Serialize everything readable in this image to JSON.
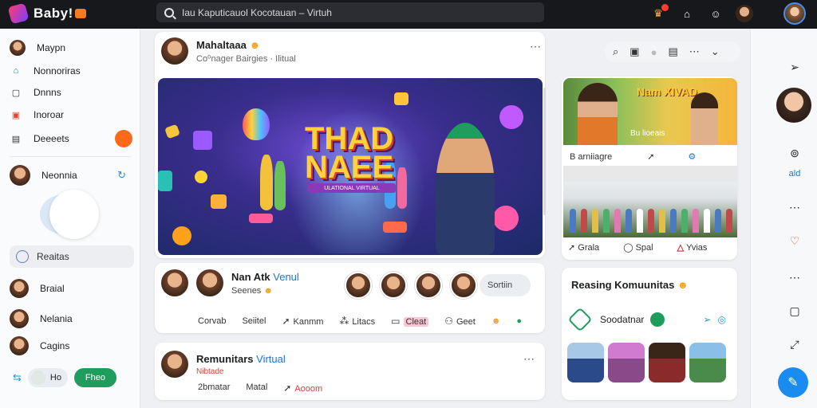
{
  "app": {
    "logo_text": "Baby!"
  },
  "search": {
    "value": "Iau Kaputicauol Kocotauan – Virtuh"
  },
  "sidebar": {
    "items": [
      {
        "label": "Maypn",
        "icon": "profile-icon"
      },
      {
        "label": "Nonnoriras",
        "icon": "notifications-icon"
      },
      {
        "label": "Dnnns",
        "icon": "messages-icon"
      },
      {
        "label": "Inoroar",
        "icon": "events-icon"
      },
      {
        "label": "Deeeets",
        "icon": "saved-icon"
      }
    ],
    "community": {
      "label": "Neonnia"
    },
    "search_pill": "Reaitas",
    "people": [
      {
        "label": "Braial"
      },
      {
        "label": "Nelania"
      },
      {
        "label": "Cagins"
      }
    ],
    "toggle_label": "Ho",
    "green_button": "Fheo"
  },
  "post1": {
    "author": "Mahaltaaa",
    "meta": "Co⁰nager Bairgies · Ilitual",
    "hero_title": "THAD NAEE",
    "hero_subtitle": "ULATIONAL VIRTUAL"
  },
  "composer": {
    "name": "Nan Atk",
    "name_accent": "Venul",
    "sub": "Seenes",
    "sort_label": "Sortiin",
    "actions": [
      "Corvab",
      "Seiitel",
      "Kanmm",
      "Litacs",
      "Cleat",
      "Geet"
    ]
  },
  "post2": {
    "name": "Remunitars",
    "name_accent": "Virtual",
    "tag": "Nibtade",
    "actions": [
      "2bmatar",
      "Matal",
      "Aooom"
    ]
  },
  "widget": {
    "image_title": "Nam XIVAD",
    "image_caption": "Bu lioeais",
    "row1_label": "B arniiagre",
    "row2": [
      "Grala",
      "Spal",
      "Yvias"
    ]
  },
  "communities": {
    "title": "Reasing Komuunitas",
    "item_label": "Soodatnar"
  },
  "rail": {
    "label": "ald"
  },
  "colors": {
    "accent": "#1a73e8",
    "brand": "#ff3d6e",
    "green": "#1e9d5c",
    "alert": "#ff3b30"
  }
}
